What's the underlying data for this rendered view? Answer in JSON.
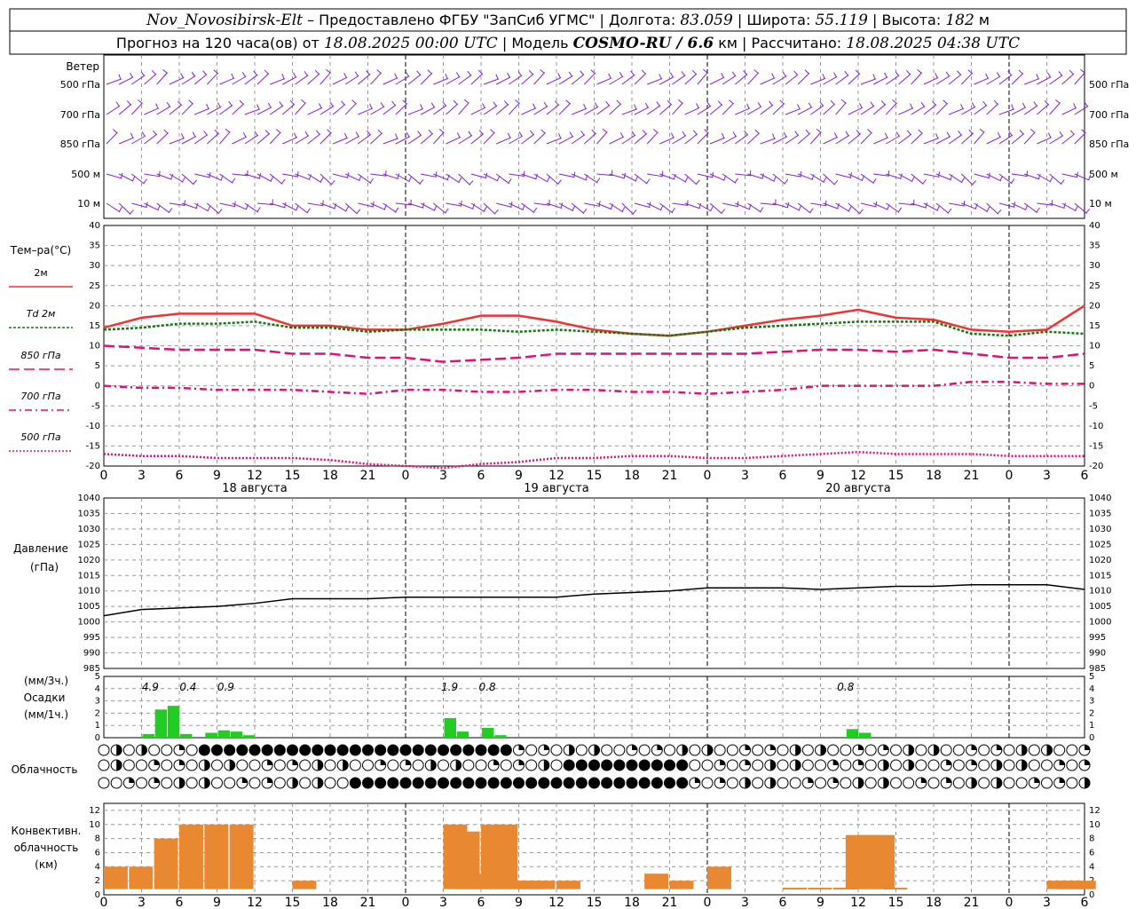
{
  "header": {
    "station": "Nov_Novosibirsk-Elt",
    "provider": "– Предоставлено ФГБУ \"ЗапСиб УГМС\"",
    "lon_label": "Долгота:",
    "lon": "83.059",
    "lat_label": "Широта:",
    "lat": "55.119",
    "alt_label": "Высота:",
    "alt": "182",
    "alt_unit": "м",
    "forecast_label": "Прогноз на 120 часа(ов) от",
    "forecast_from": "18.08.2025 00:00 UTC",
    "model_label": "Модель",
    "model": "COSMO-RU / 6.6",
    "model_unit": "км",
    "calc_label": "Рассчитано:",
    "calc_time": "18.08.2025 04:38 UTC"
  },
  "panels": {
    "wind": {
      "title": "Ветер",
      "levels": [
        "500 гПа",
        "700 гПа",
        "850 гПа",
        "500 м",
        "10 м"
      ]
    },
    "temp": {
      "title": "Тем–ра(°C)",
      "legend": [
        {
          "label": "2м",
          "color": "#ee3333",
          "dash": ""
        },
        {
          "label": "Td 2м",
          "color": "#117711",
          "dash": "3,2"
        },
        {
          "label": "850 гПа",
          "color": "#dd1177",
          "dash": "12,5"
        },
        {
          "label": "700 гПа",
          "color": "#dd1177",
          "dash": "8,4,2,4"
        },
        {
          "label": "500 гПа",
          "color": "#dd1177",
          "dash": "2,2"
        }
      ],
      "yticks": [
        "40",
        "35",
        "30",
        "25",
        "20",
        "15",
        "10",
        "5",
        "0",
        "-5",
        "-10",
        "-15",
        "-20"
      ]
    },
    "pressure": {
      "title": "Давление",
      "unit": "(гПа)",
      "yticks": [
        "1040",
        "1035",
        "1030",
        "1025",
        "1020",
        "1015",
        "1010",
        "1005",
        "1000",
        "995",
        "990",
        "985"
      ]
    },
    "precip": {
      "unit3": "(мм/3ч.)",
      "title": "Осадки",
      "unit1": "(мм/1ч.)",
      "yticks": [
        "5",
        "4",
        "3",
        "2",
        "1",
        "0"
      ],
      "totals": [
        "4.9",
        "0.4",
        "0.9",
        "1.9",
        "0.8",
        "0.8"
      ]
    },
    "clouds": {
      "title": "Облачность"
    },
    "conv": {
      "title1": "Конвективн.",
      "title2": "облачность",
      "title3": "(км)",
      "yticks": [
        "12",
        "10",
        "8",
        "6",
        "4",
        "2",
        "0"
      ]
    }
  },
  "x_axis": {
    "hour_labels": [
      "0",
      "3",
      "6",
      "9",
      "12",
      "15",
      "18",
      "21",
      "0",
      "3",
      "6",
      "9",
      "12",
      "15",
      "18",
      "21",
      "0",
      "3",
      "6",
      "9",
      "12",
      "15",
      "18",
      "21",
      "0",
      "3",
      "6"
    ],
    "date_labels": [
      "18 августа",
      "19 августа",
      "20 августа"
    ]
  },
  "colors": {
    "wind": "#8822cc",
    "t2m": "#ee3333",
    "td2m": "#117711",
    "upper": "#dd1177",
    "pressure": "#000000",
    "precip": "#22cc22",
    "conv": "#e88830",
    "grid": "#999999"
  },
  "chart_data": [
    {
      "type": "line",
      "title": "Тем–ра(°C)",
      "x_unit": "hours since 18.08.2025 00:00 UTC",
      "ylim": [
        -20,
        40
      ],
      "x": [
        0,
        3,
        6,
        9,
        12,
        15,
        18,
        21,
        24,
        27,
        30,
        33,
        36,
        39,
        42,
        45,
        48,
        51,
        54,
        57,
        60,
        63,
        66,
        69,
        72,
        75,
        78
      ],
      "series": [
        {
          "name": "2м",
          "values": [
            14.5,
            17,
            18,
            18,
            18,
            15,
            15,
            14,
            14,
            15.5,
            17.5,
            17.5,
            16,
            14,
            13,
            12.5,
            13.5,
            15,
            16.5,
            17.5,
            19,
            17,
            16.5,
            14,
            13.5,
            14,
            20
          ]
        },
        {
          "name": "Td 2м",
          "values": [
            14,
            14.5,
            15.5,
            15.5,
            16,
            14.5,
            14.5,
            13.5,
            14,
            14,
            14,
            13.5,
            14,
            13.5,
            13,
            12.5,
            13.5,
            14.5,
            15,
            15.5,
            16,
            16,
            16,
            13,
            12.5,
            13.5,
            13
          ]
        },
        {
          "name": "850 гПа",
          "values": [
            10,
            9.5,
            9,
            9,
            9,
            8,
            8,
            7,
            7,
            6,
            6.5,
            7,
            8,
            8,
            8,
            8,
            8,
            8,
            8.5,
            9,
            9,
            8.5,
            9,
            8,
            7,
            7,
            8
          ]
        },
        {
          "name": "700 гПа",
          "values": [
            0,
            -0.5,
            -0.5,
            -1,
            -1,
            -1,
            -1.5,
            -2,
            -1,
            -1,
            -1.5,
            -1.5,
            -1,
            -1,
            -1.5,
            -1.5,
            -2,
            -1.5,
            -1,
            0,
            0,
            0,
            0,
            1,
            1,
            0.5,
            0.5
          ]
        },
        {
          "name": "500 гПа",
          "values": [
            -17,
            -17.5,
            -17.5,
            -18,
            -18,
            -18,
            -18.5,
            -19.5,
            -20,
            -20.5,
            -19.5,
            -19,
            -18,
            -18,
            -17.5,
            -17.5,
            -18,
            -18,
            -17.5,
            -17,
            -16.5,
            -17,
            -17,
            -17,
            -17.5,
            -17.5,
            -17.5
          ]
        }
      ]
    },
    {
      "type": "line",
      "title": "Давление",
      "x_unit": "hours since 18.08.2025 00:00 UTC",
      "ylim": [
        985,
        1040
      ],
      "x": [
        0,
        3,
        6,
        9,
        12,
        15,
        18,
        21,
        24,
        27,
        30,
        33,
        36,
        39,
        42,
        45,
        48,
        51,
        54,
        57,
        60,
        63,
        66,
        69,
        72,
        75,
        78
      ],
      "series": [
        {
          "name": "",
          "values": [
            1002,
            1004,
            1004.5,
            1005,
            1006,
            1007.5,
            1007.5,
            1007.5,
            1008,
            1008,
            1008,
            1008,
            1008,
            1009,
            1009.5,
            1010,
            1011,
            1011,
            1011,
            1010.5,
            1011,
            1011.5,
            1011.5,
            1012,
            1012,
            1012,
            1010.5
          ]
        }
      ]
    },
    {
      "type": "bar",
      "title": "Осадки",
      "x_unit": "hours since 18.08.2025 00:00 UTC",
      "ylim": [
        0,
        5
      ],
      "x": [
        3,
        4,
        5,
        6,
        8,
        9,
        10,
        11,
        27,
        28,
        30,
        31,
        59,
        60
      ],
      "values": [
        0.3,
        2.3,
        2.6,
        0.3,
        0.4,
        0.6,
        0.5,
        0.2,
        1.6,
        0.5,
        0.8,
        0.2,
        0.7,
        0.4
      ]
    },
    {
      "type": "bar",
      "title": "Конвективн. облачность",
      "x_unit": "hours since 18.08.2025 00:00 UTC",
      "ylim": [
        0,
        12
      ],
      "series": [
        {
          "name": "",
          "x": [
            0,
            2,
            4,
            6,
            8,
            10,
            15,
            24,
            27,
            28,
            29,
            30,
            31,
            32,
            33,
            34,
            36,
            43,
            45,
            48,
            54,
            56,
            58,
            59,
            60,
            61,
            62,
            75,
            76,
            77
          ],
          "values": [
            4,
            4,
            8,
            10,
            10,
            10,
            2,
            0,
            10,
            9,
            3,
            10,
            10,
            2,
            2,
            2,
            2,
            3,
            2,
            4,
            1,
            1,
            1,
            8.5,
            8.5,
            8.5,
            1,
            2,
            2,
            2
          ]
        }
      ]
    }
  ]
}
